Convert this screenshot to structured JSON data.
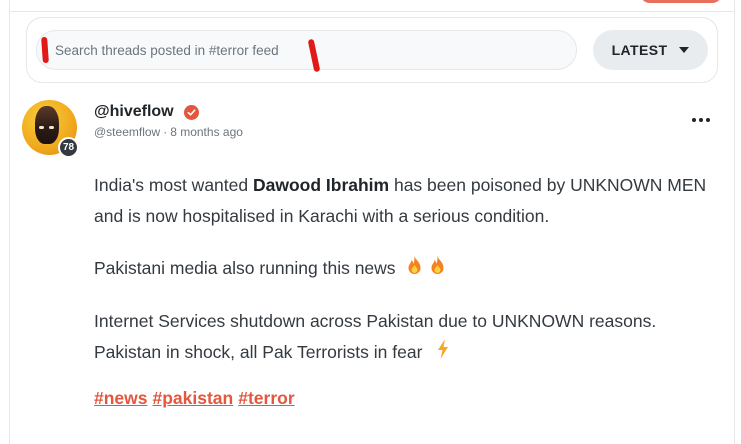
{
  "search": {
    "placeholder": "Search threads posted in #terror feed",
    "sort_label": "LATEST"
  },
  "post": {
    "author": "@hiveflow",
    "reputation": "78",
    "community": "@steemflow",
    "time": "8 months ago",
    "paragraph1": {
      "pre": "India's most wanted ",
      "bold": "Dawood Ibrahim",
      "post": " has been poisoned by UNKNOWN MEN and is now hospitalised in Karachi with a serious condition."
    },
    "paragraph2": "Pakistani media also running this news",
    "paragraph3_line1": "Internet Services shutdown across Pakistan due to UNKNOWN reasons.",
    "paragraph3_line2": "Pakistan in shock, all Pak Terrorists in fear",
    "tags": [
      "#news",
      "#pakistan",
      "#terror"
    ]
  },
  "icons": {
    "verified": "verified-check-icon",
    "more": "more-horizontal-icon",
    "fire": "fire-emoji-icon",
    "lightning": "lightning-emoji-icon"
  },
  "colors": {
    "accent": "#e3573f",
    "text": "#343a40",
    "muted": "#6c757d",
    "button_bg": "#e9ecef"
  }
}
